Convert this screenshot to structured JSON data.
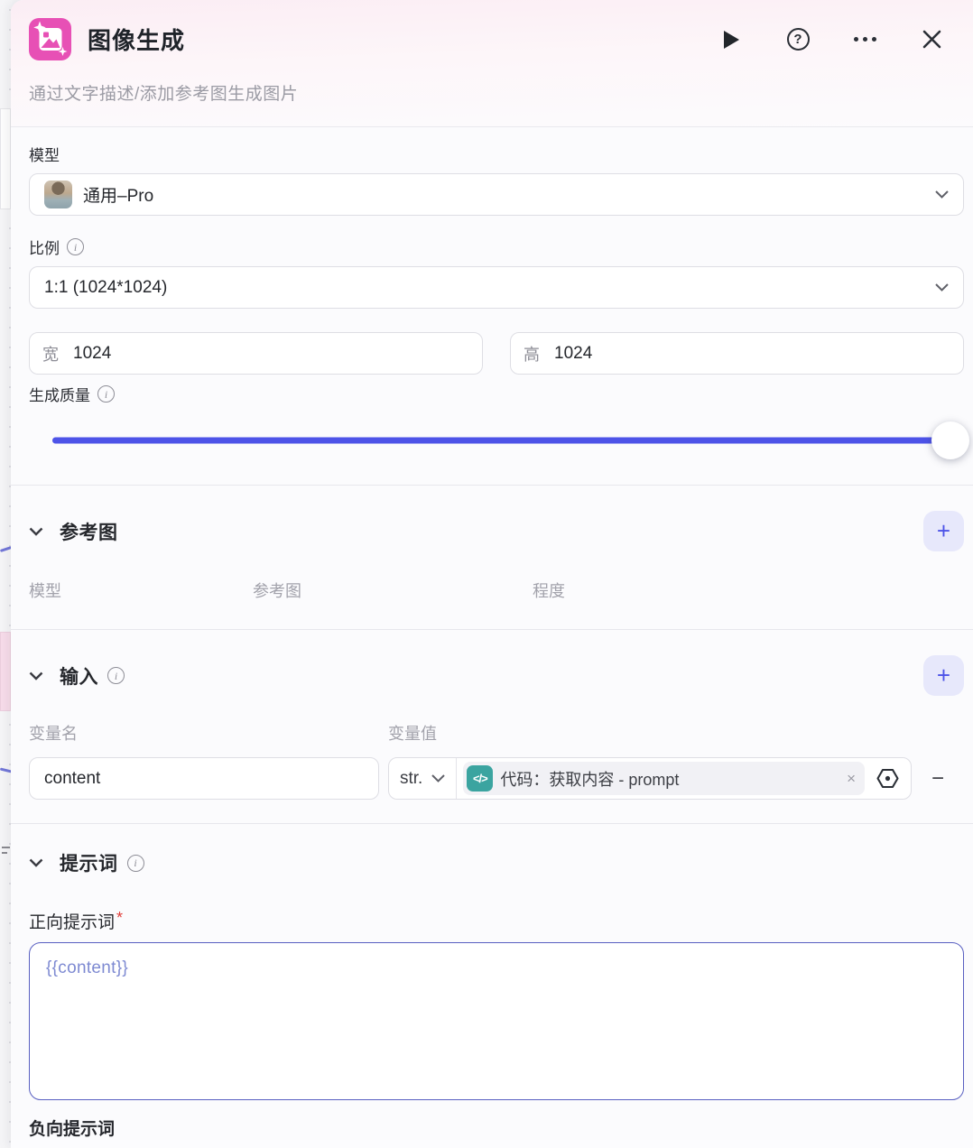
{
  "header": {
    "title": "图像生成",
    "subtitle": "通过文字描述/添加参考图生成图片",
    "help_glyph": "?"
  },
  "form": {
    "model": {
      "label": "模型",
      "value": "通用–Pro"
    },
    "ratio": {
      "label": "比例",
      "value": "1:1 (1024*1024)"
    },
    "width": {
      "prefix": "宽",
      "value": "1024"
    },
    "height": {
      "prefix": "高",
      "value": "1024"
    },
    "quality": {
      "label": "生成质量",
      "value_percent": 100
    }
  },
  "reference_section": {
    "title": "参考图",
    "add_label": "+",
    "columns": [
      "模型",
      "参考图",
      "程度"
    ]
  },
  "input_section": {
    "title": "输入",
    "add_label": "+",
    "columns": [
      "变量名",
      "变量值"
    ],
    "rows": [
      {
        "name": "content",
        "type": "str.",
        "value_tag": "代码：获取内容 - prompt",
        "code_glyph": "</>",
        "remove_label": "−",
        "close_label": "×"
      }
    ]
  },
  "prompt_section": {
    "title": "提示词",
    "positive_label": "正向提示词",
    "required_mark": "*",
    "positive_value": "{{content}}",
    "negative_label": "负向提示词"
  },
  "colors": {
    "accent": "#4d53e8",
    "brand": "#e750b5",
    "teal": "#3ba4a0",
    "required": "#e0403c"
  }
}
